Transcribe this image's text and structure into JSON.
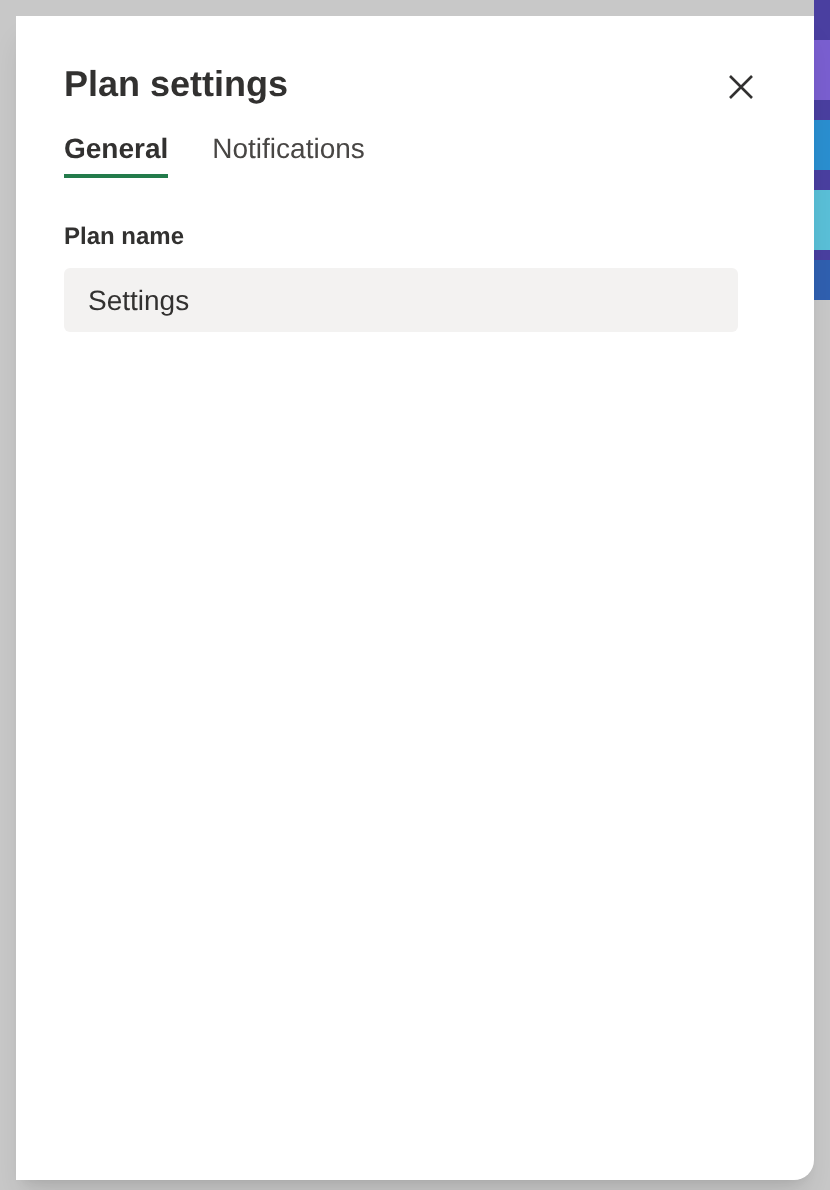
{
  "dialog": {
    "title": "Plan settings"
  },
  "tabs": [
    {
      "label": "General",
      "selected": true
    },
    {
      "label": "Notifications",
      "selected": false
    }
  ],
  "plan_name": {
    "label": "Plan name",
    "value": "Settings"
  }
}
